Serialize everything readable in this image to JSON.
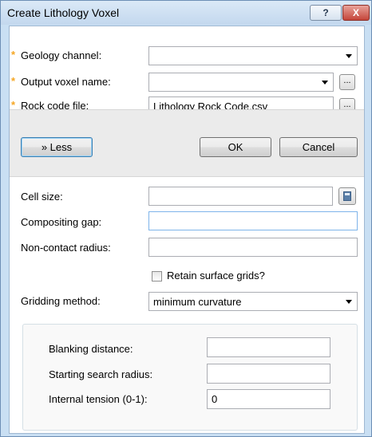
{
  "window": {
    "title": "Create Lithology Voxel",
    "help_label": "?",
    "close_label": "X"
  },
  "required": {
    "marker": "*",
    "geology_channel_label": "Geology channel:",
    "geology_channel_value": "",
    "output_voxel_label": "Output voxel name:",
    "output_voxel_value": "",
    "rock_code_label": "Rock code file:",
    "rock_code_value": "Lithology Rock Code.csv",
    "browse_label": "..."
  },
  "buttons": {
    "less_label": "» Less",
    "ok_label": "OK",
    "cancel_label": "Cancel"
  },
  "options": {
    "cell_size_label": "Cell size:",
    "cell_size_value": "",
    "compositing_gap_label": "Compositing gap:",
    "compositing_gap_value": "",
    "non_contact_label": "Non-contact radius:",
    "non_contact_value": "",
    "retain_label": "Retain surface grids?",
    "retain_checked": false,
    "gridding_label": "Gridding method:",
    "gridding_value": "minimum curvature"
  },
  "gridding_params": {
    "blanking_label": "Blanking distance:",
    "blanking_value": "",
    "search_radius_label": "Starting search radius:",
    "search_radius_value": "",
    "tension_label": "Internal tension (0-1):",
    "tension_value": "0"
  },
  "colors": {
    "required_star": "#f5a623",
    "window_frame": "#c9dff3"
  }
}
